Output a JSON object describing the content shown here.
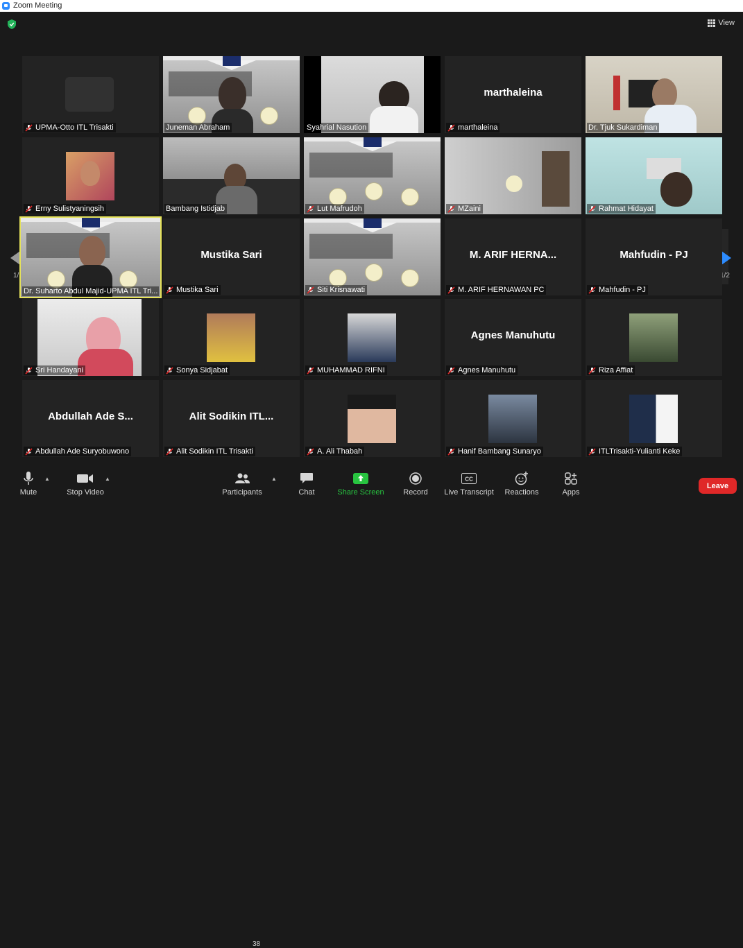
{
  "window": {
    "title": "Zoom Meeting"
  },
  "view": {
    "label": "View"
  },
  "pagination": {
    "left": "1/2",
    "right": "1/2"
  },
  "tiles": [
    {
      "name": "UPMA-Otto ITL Trisakti",
      "big": ""
    },
    {
      "name": "Juneman Abraham",
      "big": ""
    },
    {
      "name": "Syahrial Nasution",
      "big": ""
    },
    {
      "name": "marthaleina",
      "big": "marthaleina"
    },
    {
      "name": "Dr. Tjuk Sukardiman",
      "big": ""
    },
    {
      "name": "Erny Sulistyaningsih",
      "big": ""
    },
    {
      "name": "Bambang Istidjab",
      "big": ""
    },
    {
      "name": "Lut Mafrudoh",
      "big": ""
    },
    {
      "name": "MZaini",
      "big": ""
    },
    {
      "name": "Rahmat Hidayat",
      "big": ""
    },
    {
      "name": "Dr. Suharto Abdul Majid-UPMA ITL Tri...",
      "big": ""
    },
    {
      "name": "Mustika Sari",
      "big": "Mustika Sari"
    },
    {
      "name": "Siti Krisnawati",
      "big": ""
    },
    {
      "name": "M. ARIF HERNAWAN  PC",
      "big": "M. ARIF HERNA..."
    },
    {
      "name": "Mahfudin - PJ",
      "big": "Mahfudin - PJ"
    },
    {
      "name": "Sri Handayani",
      "big": ""
    },
    {
      "name": "Sonya Sidjabat",
      "big": ""
    },
    {
      "name": "MUHAMMAD RIFNI",
      "big": ""
    },
    {
      "name": "Agnes Manuhutu",
      "big": "Agnes Manuhutu"
    },
    {
      "name": "Riza Affiat",
      "big": ""
    },
    {
      "name": "Abdullah Ade Suryobuwono",
      "big": "Abdullah Ade S..."
    },
    {
      "name": "Alit Sodikin ITL Trisakti",
      "big": "Alit Sodikin ITL..."
    },
    {
      "name": "A. Ali Thabah",
      "big": ""
    },
    {
      "name": "Hanif Bambang Sunaryo",
      "big": ""
    },
    {
      "name": "ITLTrisakti-Yulianti Keke",
      "big": ""
    }
  ],
  "toolbar": {
    "mute": "Mute",
    "stop_video": "Stop Video",
    "participants": "Participants",
    "participants_count": "38",
    "chat": "Chat",
    "share_screen": "Share Screen",
    "record": "Record",
    "live_transcript": "Live Transcript",
    "reactions": "Reactions",
    "apps": "Apps",
    "leave": "Leave"
  },
  "colors": {
    "accent_blue": "#2d8cff",
    "share_green": "#28c440",
    "leave_red": "#e02828",
    "active_speaker": "#e6e35a",
    "muted_red": "#e02828"
  }
}
